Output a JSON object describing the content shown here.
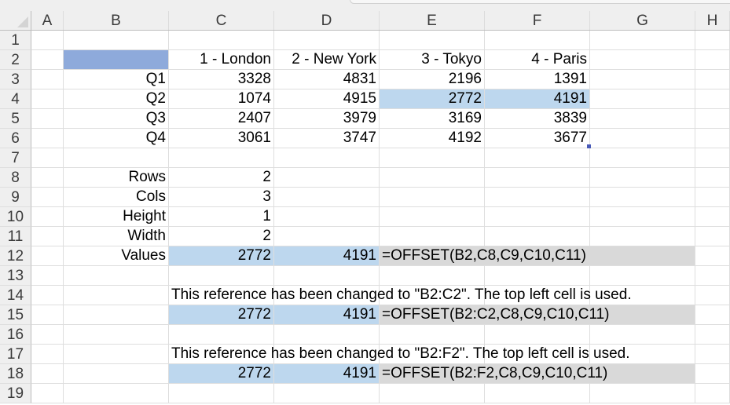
{
  "columns": [
    "A",
    "B",
    "C",
    "D",
    "E",
    "F",
    "G",
    "H"
  ],
  "rows": [
    "1",
    "2",
    "3",
    "4",
    "5",
    "6",
    "7",
    "8",
    "9",
    "10",
    "11",
    "12",
    "13",
    "14",
    "15",
    "16",
    "17",
    "18",
    "19"
  ],
  "table": {
    "headers": [
      "1 - London",
      "2 - New York",
      "3 - Tokyo",
      "4 - Paris"
    ],
    "row_labels": [
      "Q1",
      "Q2",
      "Q3",
      "Q4"
    ],
    "values": [
      [
        "3328",
        "4831",
        "2196",
        "1391"
      ],
      [
        "1074",
        "4915",
        "2772",
        "4191"
      ],
      [
        "2407",
        "3979",
        "3169",
        "3839"
      ],
      [
        "3061",
        "3747",
        "4192",
        "3677"
      ]
    ]
  },
  "params": {
    "labels": [
      "Rows",
      "Cols",
      "Height",
      "Width",
      "Values"
    ],
    "values": [
      "2",
      "3",
      "1",
      "2"
    ]
  },
  "results": {
    "row12": {
      "v1": "2772",
      "v2": "4191",
      "formula": "=OFFSET(B2,C8,C9,C10,C11)"
    },
    "note1": "This reference has been changed to \"B2:C2\". The top left cell is used.",
    "row15": {
      "v1": "2772",
      "v2": "4191",
      "formula": "=OFFSET(B2:C2,C8,C9,C10,C11)"
    },
    "note2": "This reference has been changed to \"B2:F2\". The top left cell is used.",
    "row18": {
      "v1": "2772",
      "v2": "4191",
      "formula": "=OFFSET(B2:F2,C8,C9,C10,C11)"
    }
  },
  "colors": {
    "highlight_blue": "#bdd7ee",
    "header_blue": "#8eaadb",
    "formula_gray": "#d9d9d9"
  }
}
